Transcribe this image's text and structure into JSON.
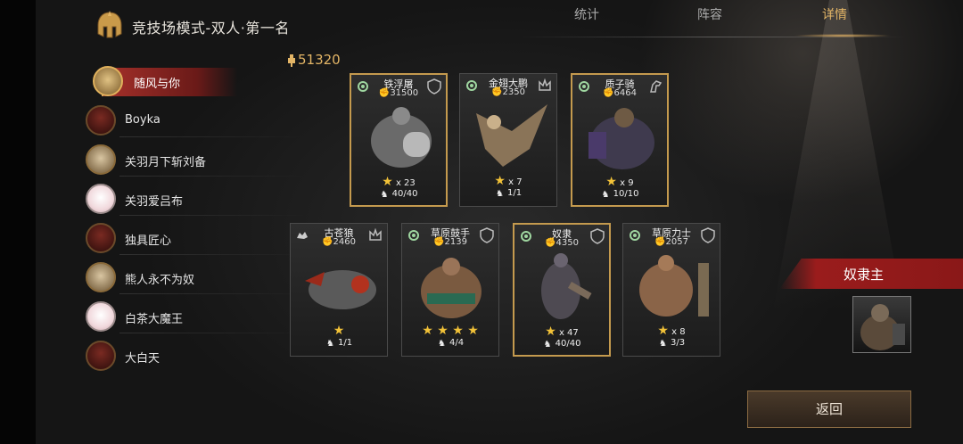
{
  "header": {
    "title": "竞技场模式-双人·第一名"
  },
  "tabs": [
    {
      "label": "统计"
    },
    {
      "label": "阵容"
    },
    {
      "label": "详情"
    }
  ],
  "active_tab": "详情",
  "players": [
    {
      "name": "随风与你"
    },
    {
      "name": "Boyka"
    },
    {
      "name": "关羽月下斩刘备"
    },
    {
      "name": "关羽爱吕布"
    },
    {
      "name": "独具匠心"
    },
    {
      "name": "熊人永不为奴"
    },
    {
      "name": "白茶大魔王"
    },
    {
      "name": "大白天"
    }
  ],
  "total_power": "51320",
  "units": [
    {
      "name": "铁浮屠",
      "power": "31500",
      "stars_text": "x 23",
      "count": "40/40"
    },
    {
      "name": "金翅大鹏",
      "power": "2350",
      "stars_text": "x 7",
      "count": "1/1"
    },
    {
      "name": "质子骑",
      "power": "6464",
      "stars_text": "x 9",
      "count": "10/10"
    },
    {
      "name": "古苍狼",
      "power": "2460",
      "stars_text": "",
      "count": "1/1"
    },
    {
      "name": "草原鼓手",
      "power": "2139",
      "stars_text": "",
      "count": "4/4"
    },
    {
      "name": "奴隶",
      "power": "4350",
      "stars_text": "x 47",
      "count": "40/40"
    },
    {
      "name": "草原力士",
      "power": "2057",
      "stars_text": "x 8",
      "count": "3/3"
    }
  ],
  "commander": {
    "title": "奴隶主"
  },
  "back_button": "返回",
  "colors": {
    "accent_gold": "#e3b566",
    "banner_red": "#9a1c1c",
    "star_yellow": "#f2c238"
  }
}
